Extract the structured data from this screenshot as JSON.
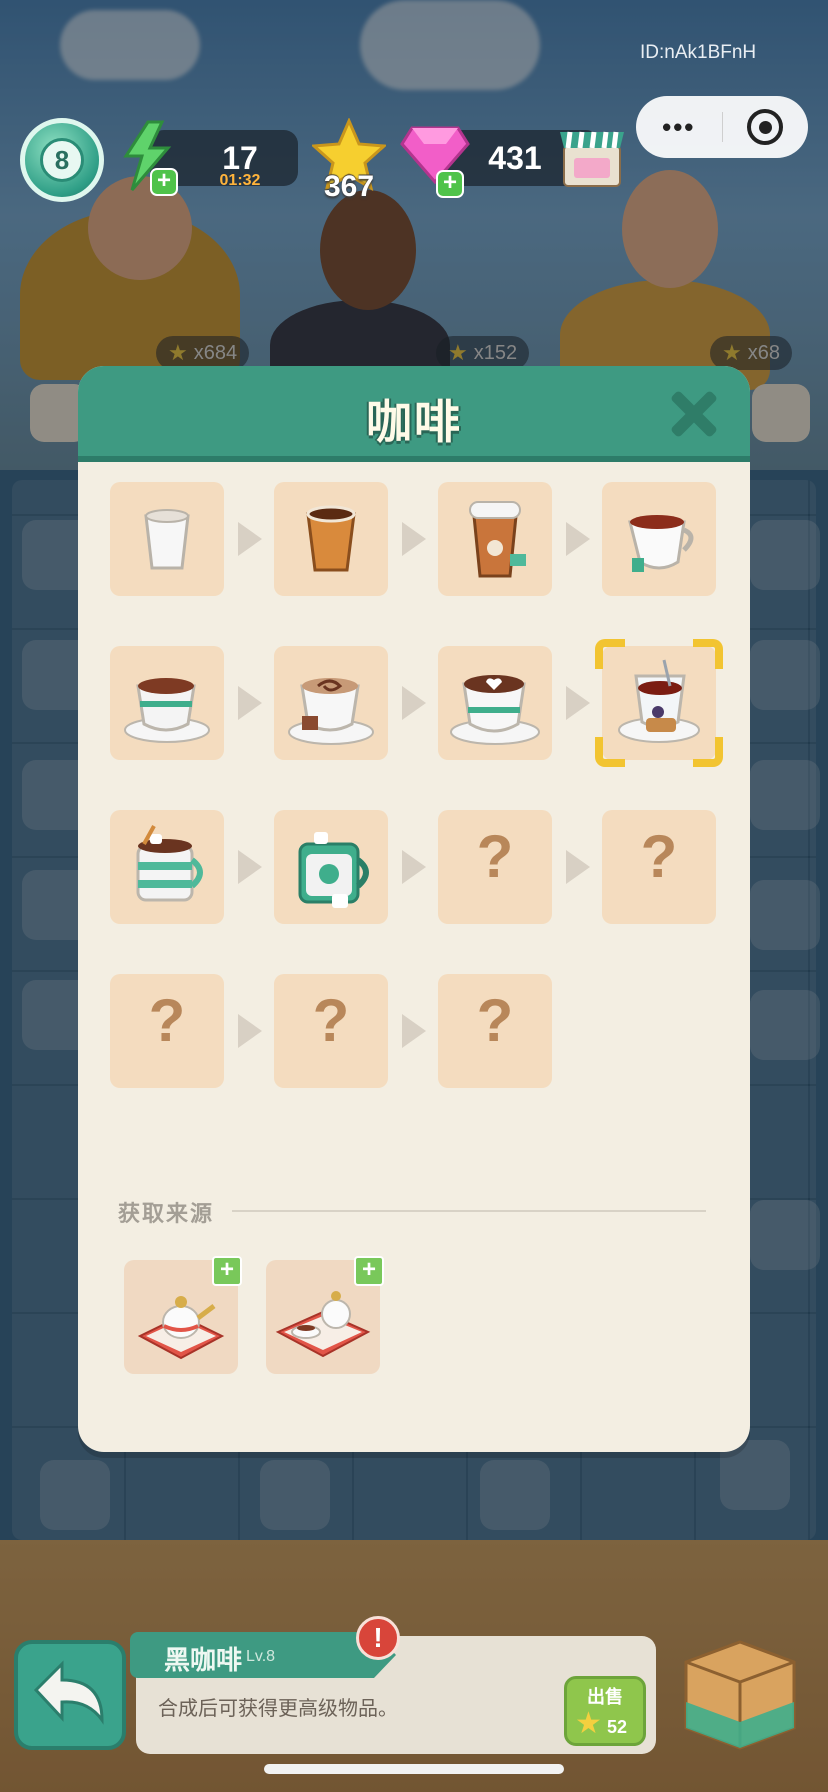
{
  "hud": {
    "game_id": "ID:nAk1BFnH",
    "level": "8",
    "energy": "17",
    "energy_timer": "01:32",
    "stars": "367",
    "gems": "431",
    "menu_dots": "•••"
  },
  "characters": [
    {
      "count": "x684"
    },
    {
      "count": "x152"
    },
    {
      "count": "x68"
    }
  ],
  "modal": {
    "title": "咖啡",
    "tiles": [
      {
        "icon": "paper-cup-empty",
        "known": true
      },
      {
        "icon": "paper-cup-coffee",
        "known": true
      },
      {
        "icon": "takeaway-coffee",
        "known": true
      },
      {
        "icon": "tea-cup",
        "known": true
      },
      {
        "icon": "hot-chocolate-cup",
        "known": true
      },
      {
        "icon": "cappuccino-swirl",
        "known": true
      },
      {
        "icon": "latte-heart",
        "known": true
      },
      {
        "icon": "coffee-with-cookies",
        "known": true,
        "selected": true
      },
      {
        "icon": "striped-mug-marshmallow",
        "known": true
      },
      {
        "icon": "coffee-mug-marshmallow",
        "known": true
      },
      {
        "icon": "unknown",
        "known": false,
        "text": "?"
      },
      {
        "icon": "unknown",
        "known": false,
        "text": "?"
      },
      {
        "icon": "unknown",
        "known": false,
        "text": "?"
      },
      {
        "icon": "unknown",
        "known": false,
        "text": "?"
      },
      {
        "icon": "unknown",
        "known": false,
        "text": "?"
      }
    ],
    "source_label": "获取来源",
    "sources": [
      {
        "icon": "teapot-tray"
      },
      {
        "icon": "tea-set-tray"
      }
    ]
  },
  "bottom": {
    "item_name": "黑咖啡",
    "item_level": "Lv.8",
    "description": "合成后可获得更高级物品。",
    "alert": "!",
    "sell_label": "出售",
    "sell_value": "52"
  },
  "colors": {
    "header_green": "#3e9a82",
    "tile_bg": "#f4dcbf",
    "panel_bg": "#f3eee2",
    "select_yellow": "#f2c431",
    "question_brown": "#b8875a"
  }
}
